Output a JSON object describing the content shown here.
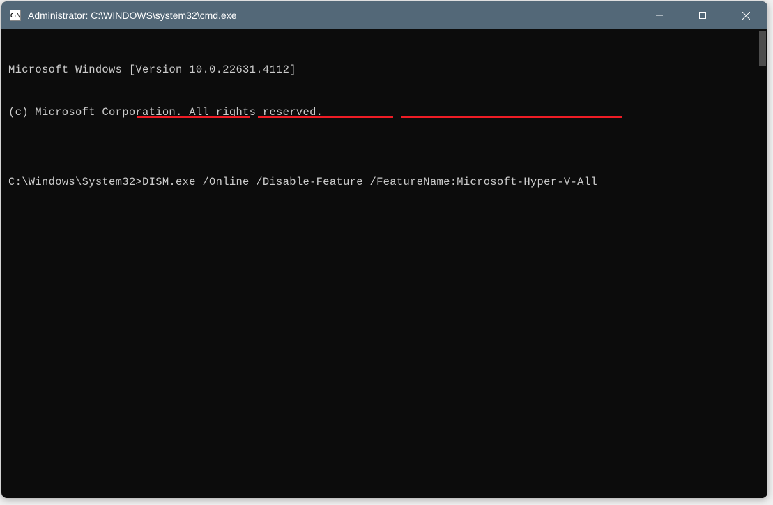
{
  "window": {
    "title": "Administrator: C:\\WINDOWS\\system32\\cmd.exe",
    "icon_label": "C:\\"
  },
  "terminal": {
    "line1": "Microsoft Windows [Version 10.0.22631.4112]",
    "line2": "(c) Microsoft Corporation. All rights reserved.",
    "blank": "",
    "prompt": "C:\\Windows\\System32>",
    "command": "DISM.exe /Online /Disable-Feature /FeatureName:Microsoft-Hyper-V-All"
  },
  "colors": {
    "titlebar_bg": "#536878",
    "terminal_bg": "#0c0c0c",
    "terminal_fg": "#cccccc",
    "annotation_red": "#ee1c25"
  }
}
